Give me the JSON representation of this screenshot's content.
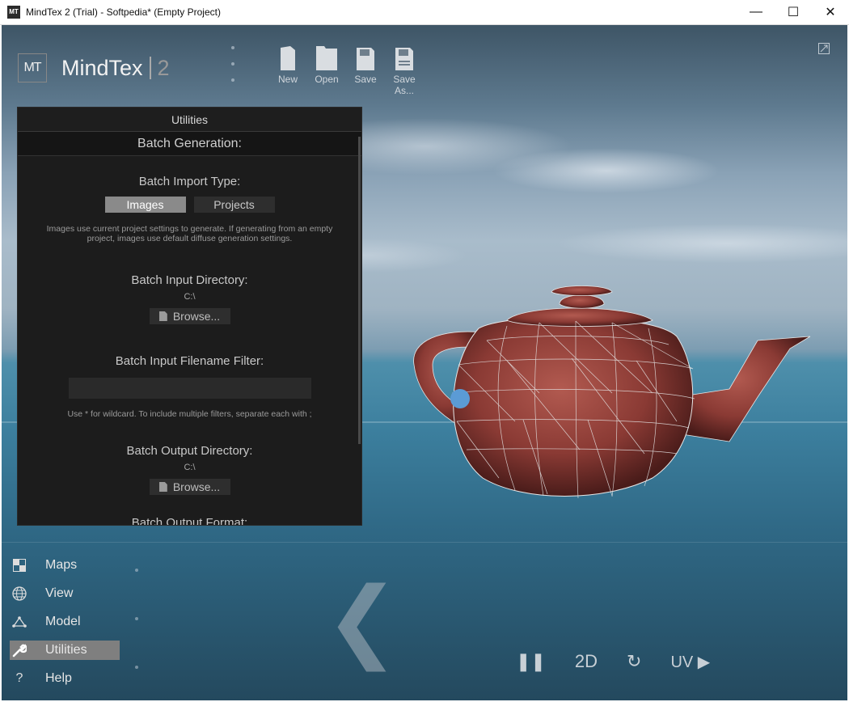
{
  "window": {
    "title": "MindTex 2 (Trial) - Softpedia* (Empty Project)",
    "icon_label": "MT",
    "minimize_glyph": "—",
    "maximize_glyph": "☐",
    "close_glyph": "✕"
  },
  "logo": {
    "mark": "MT",
    "name": "MindTex",
    "version": "2"
  },
  "toolbar": {
    "new_label": "New",
    "open_label": "Open",
    "save_label": "Save",
    "save_as_label": "Save As..."
  },
  "panel": {
    "title": "Utilities",
    "section_title": "Batch Generation:",
    "import_type": {
      "label": "Batch Import Type:",
      "options": [
        "Images",
        "Projects"
      ],
      "selected": "Images",
      "hint": "Images use current project settings to generate. If generating from an empty project, images use default diffuse generation settings."
    },
    "input_dir": {
      "label": "Batch Input Directory:",
      "value": "C:\\",
      "browse_label": "Browse..."
    },
    "filename_filter": {
      "label": "Batch Input Filename Filter:",
      "value": "",
      "hint": "Use * for wildcard. To include multiple filters, separate each with ;"
    },
    "output_dir": {
      "label": "Batch Output Directory:",
      "value": "C:\\",
      "browse_label": "Browse..."
    },
    "output_format": {
      "label": "Batch Output Format:"
    }
  },
  "nav": {
    "items": [
      {
        "label": "Maps",
        "icon": "maps-icon",
        "active": false
      },
      {
        "label": "View",
        "icon": "globe-icon",
        "active": false
      },
      {
        "label": "Model",
        "icon": "model-icon",
        "active": false
      },
      {
        "label": "Utilities",
        "icon": "wrench-icon",
        "active": true
      },
      {
        "label": "Help",
        "icon": "help-icon",
        "active": false
      }
    ]
  },
  "controls": {
    "pause_glyph": "❚❚",
    "mode_2d": "2D",
    "reset_glyph": "↻",
    "uv_label": "UV ▶"
  },
  "colors": {
    "panel_bg": "#1c1c1c",
    "toggle_active": "#8a8a8a",
    "nav_active": "#7f7f7f",
    "teapot": "#8a3a34",
    "cursor": "#5b9bd5"
  }
}
